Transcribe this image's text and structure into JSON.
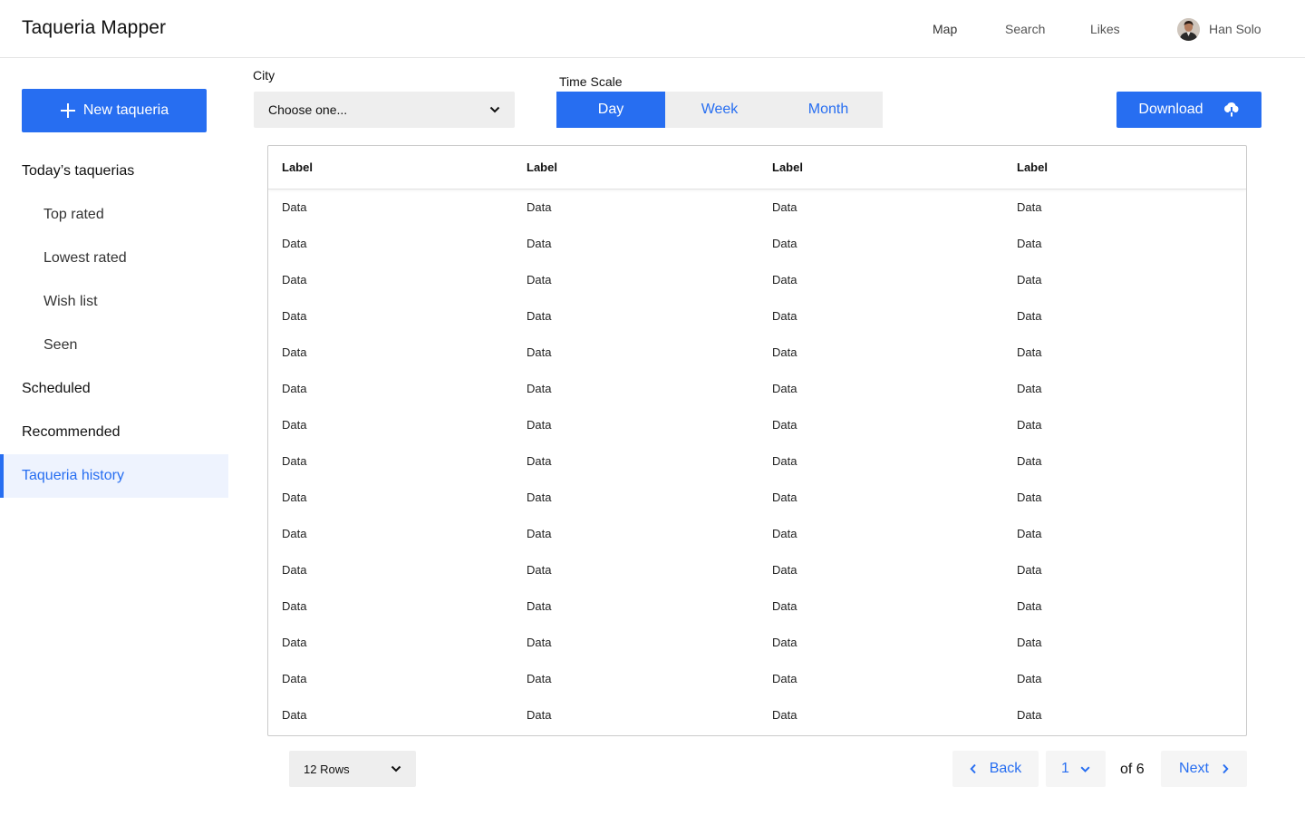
{
  "app": {
    "title": "Taqueria Mapper"
  },
  "header": {
    "nav": [
      "Map",
      "Search",
      "Likes"
    ],
    "user_name": "Han Solo"
  },
  "sidebar": {
    "new_button_label": "New taqueria",
    "items": [
      {
        "label": "Today’s taquerias",
        "level": 1
      },
      {
        "label": "Top rated",
        "level": 2
      },
      {
        "label": "Lowest rated",
        "level": 2
      },
      {
        "label": "Wish list",
        "level": 2
      },
      {
        "label": "Seen",
        "level": 2
      },
      {
        "label": "Scheduled",
        "level": 1
      },
      {
        "label": "Recommended",
        "level": 1
      },
      {
        "label": "Taqueria history",
        "level": 1,
        "active": true
      }
    ]
  },
  "filters": {
    "city_label": "City",
    "city_value": "Choose one...",
    "timescale_label": "Time Scale",
    "timescale_options": [
      "Day",
      "Week",
      "Month"
    ],
    "timescale_selected": "Day",
    "download_label": "Download"
  },
  "table": {
    "columns": [
      "Label",
      "Label",
      "Label",
      "Label"
    ],
    "rows": [
      [
        "Data",
        "Data",
        "Data",
        "Data"
      ],
      [
        "Data",
        "Data",
        "Data",
        "Data"
      ],
      [
        "Data",
        "Data",
        "Data",
        "Data"
      ],
      [
        "Data",
        "Data",
        "Data",
        "Data"
      ],
      [
        "Data",
        "Data",
        "Data",
        "Data"
      ],
      [
        "Data",
        "Data",
        "Data",
        "Data"
      ],
      [
        "Data",
        "Data",
        "Data",
        "Data"
      ],
      [
        "Data",
        "Data",
        "Data",
        "Data"
      ],
      [
        "Data",
        "Data",
        "Data",
        "Data"
      ],
      [
        "Data",
        "Data",
        "Data",
        "Data"
      ],
      [
        "Data",
        "Data",
        "Data",
        "Data"
      ],
      [
        "Data",
        "Data",
        "Data",
        "Data"
      ],
      [
        "Data",
        "Data",
        "Data",
        "Data"
      ],
      [
        "Data",
        "Data",
        "Data",
        "Data"
      ],
      [
        "Data",
        "Data",
        "Data",
        "Data"
      ]
    ]
  },
  "pagination": {
    "rows_value": "12 Rows",
    "back_label": "Back",
    "page_value": "1",
    "of_label": "of 6",
    "next_label": "Next"
  },
  "colors": {
    "accent": "#276ef1",
    "active_bg": "#eef3fe",
    "control_bg": "#eeeeee"
  }
}
